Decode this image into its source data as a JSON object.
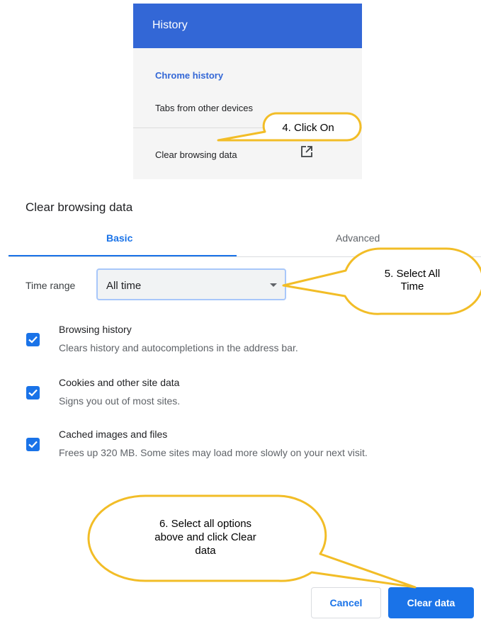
{
  "history_panel": {
    "header": "History",
    "items": [
      {
        "label": "Chrome history",
        "active": true
      },
      {
        "label": "Tabs from other devices",
        "active": false
      },
      {
        "label": "Clear browsing data",
        "active": false
      }
    ],
    "header_color": "#3367d6",
    "item_icon": "external-link-icon"
  },
  "dialog": {
    "title": "Clear browsing data",
    "tabs": [
      {
        "label": "Basic",
        "selected": true
      },
      {
        "label": "Advanced",
        "selected": false
      }
    ],
    "time_range": {
      "label": "Time range",
      "value": "All time"
    },
    "options": [
      {
        "title": "Browsing history",
        "description": "Clears history and autocompletions in the address bar.",
        "checked": true
      },
      {
        "title": "Cookies and other site data",
        "description": "Signs you out of most sites.",
        "checked": true
      },
      {
        "title": "Cached images and files",
        "description": "Frees up 320 MB. Some sites may load more slowly on your next visit.",
        "checked": true
      }
    ],
    "buttons": {
      "cancel": "Cancel",
      "clear": "Clear data"
    },
    "accent_color": "#1a73e8"
  },
  "callouts": [
    {
      "lines": [
        "4. Click On"
      ]
    },
    {
      "lines": [
        "5. Select All",
        "Time"
      ]
    },
    {
      "lines": [
        "6. Select all options",
        "above and click Clear",
        "data"
      ]
    }
  ],
  "callout_color": "#f2bd27"
}
